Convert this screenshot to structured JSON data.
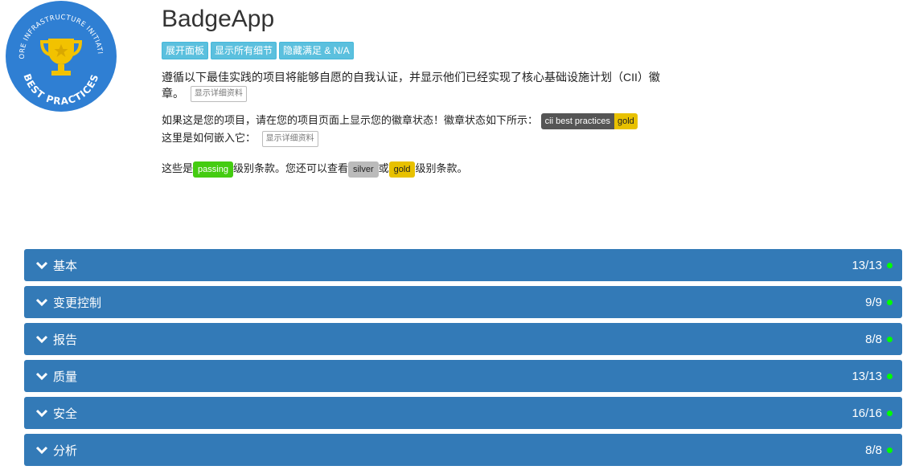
{
  "logo": {
    "ring_text": "CORE INFRASTRUCTURE INITIATIVE",
    "bottom_text": "BEST PRACTICES",
    "bg_color": "#2f7fd3",
    "trophy_color": "#f2c200"
  },
  "header": {
    "title": "BadgeApp",
    "buttons": [
      "展开面板",
      "显示所有细节",
      "隐藏满足 & N/A"
    ]
  },
  "intro": {
    "text": "遵循以下最佳实践的项目将能够自愿的自我认证，并显示他们已经实现了核心基础设施计划（CII）徽章。",
    "detail_label": "显示详细资料"
  },
  "status": {
    "text": "如果这是您的项目，请在您的项目页面上显示您的徽章状态！徽章状态如下所示：",
    "badge_left": "cii best practices",
    "badge_right": "gold",
    "embed_text": "这里是如何嵌入它：",
    "detail_label": "显示详细资料"
  },
  "levels": {
    "prefix": "这些是",
    "passing": "passing",
    "middle": "级别条款。您还可以查看",
    "silver": "silver",
    "or": "或",
    "gold": "gold",
    "suffix": "级别条款。"
  },
  "panels": [
    {
      "label": "基本",
      "count": "13/13"
    },
    {
      "label": "变更控制",
      "count": "9/9"
    },
    {
      "label": "报告",
      "count": "8/8"
    },
    {
      "label": "质量",
      "count": "13/13"
    },
    {
      "label": "安全",
      "count": "16/16"
    },
    {
      "label": "分析",
      "count": "8/8"
    }
  ]
}
